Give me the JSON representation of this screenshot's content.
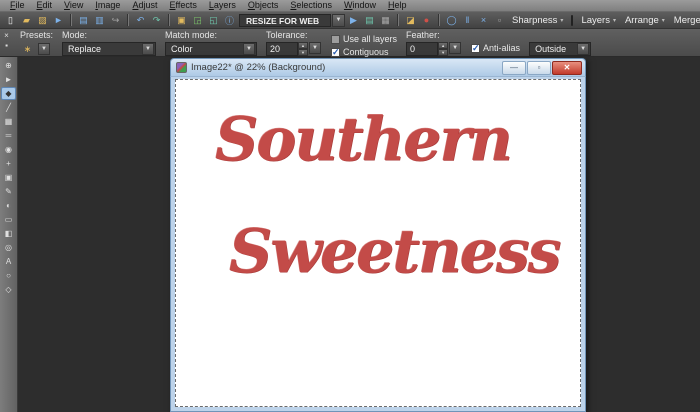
{
  "menu_bar": {
    "items": [
      {
        "label": "File"
      },
      {
        "label": "Edit"
      },
      {
        "label": "View"
      },
      {
        "label": "Image"
      },
      {
        "label": "Adjust"
      },
      {
        "label": "Effects"
      },
      {
        "label": "Layers"
      },
      {
        "label": "Objects"
      },
      {
        "label": "Selections"
      },
      {
        "label": "Window"
      },
      {
        "label": "Help"
      }
    ]
  },
  "toolbar": {
    "file_icons": [
      {
        "name": "new-file-icon",
        "glyph": "▯"
      },
      {
        "name": "open-icon",
        "glyph": "▰"
      },
      {
        "name": "browse-icon",
        "glyph": "▨"
      },
      {
        "name": "import-icon",
        "glyph": "►"
      },
      {
        "name": "save-icon",
        "glyph": "▤"
      },
      {
        "name": "save-as-icon",
        "glyph": "▥"
      },
      {
        "name": "share-icon",
        "glyph": "↪"
      },
      {
        "name": "undo-icon",
        "glyph": "↶"
      },
      {
        "name": "redo-icon",
        "glyph": "↷"
      },
      {
        "name": "paste-icon",
        "glyph": "▣"
      },
      {
        "name": "capture-icon",
        "glyph": "◲"
      },
      {
        "name": "print-icon",
        "glyph": "◱"
      },
      {
        "name": "info-icon",
        "glyph": "ⓘ"
      }
    ],
    "resize_combo": {
      "label": "RESIZE FOR WEB"
    },
    "script_icons": [
      {
        "name": "run-script-icon",
        "glyph": "▶"
      },
      {
        "name": "edit-script-icon",
        "glyph": "▤"
      },
      {
        "name": "script-output-icon",
        "glyph": "▦"
      },
      {
        "name": "open-script-icon",
        "glyph": "◪"
      },
      {
        "name": "stop-script-icon",
        "glyph": "●"
      },
      {
        "name": "record-script-icon",
        "glyph": "◯"
      },
      {
        "name": "pause-script-icon",
        "glyph": "‖"
      },
      {
        "name": "cancel-script-icon",
        "glyph": "×"
      },
      {
        "name": "save-script-icon",
        "glyph": "▫"
      }
    ],
    "right_menus": [
      {
        "label": "Sharpness"
      },
      {
        "label": "Layers"
      },
      {
        "label": "Arrange"
      },
      {
        "label": "Merge"
      }
    ]
  },
  "options_bar": {
    "palette_icons": [
      {
        "name": "close-palette-icon",
        "glyph": "×"
      },
      {
        "name": "dock-palette-icon",
        "glyph": "▪"
      }
    ],
    "presets_label": "Presets:",
    "presets_icon": {
      "name": "magic-wand-icon",
      "glyph": "∗"
    },
    "mode_label": "Mode:",
    "mode_value": "Replace",
    "match_mode_label": "Match mode:",
    "match_mode_value": "Color",
    "tolerance_label": "Tolerance:",
    "tolerance_value": "20",
    "use_all_layers_label": "Use all layers",
    "use_all_layers_checked": false,
    "contiguous_label": "Contiguous",
    "contiguous_checked": true,
    "feather_label": "Feather:",
    "feather_value": "0",
    "anti_alias_label": "Anti-alias",
    "anti_alias_checked": true,
    "edge_mode_value": "Outside"
  },
  "tool_palette": {
    "tools": [
      {
        "name": "pan-tool",
        "glyph": "⊕"
      },
      {
        "name": "pick-tool",
        "glyph": "►"
      },
      {
        "name": "magic-wand-selection-tool",
        "glyph": "◆",
        "active": true
      },
      {
        "name": "dropper-tool",
        "glyph": "╱"
      },
      {
        "name": "crop-tool",
        "glyph": "▦"
      },
      {
        "name": "straighten-tool",
        "glyph": "═"
      },
      {
        "name": "red-eye-tool",
        "glyph": "◉"
      },
      {
        "name": "makeover-tool",
        "glyph": "+"
      },
      {
        "name": "clone-brush-tool",
        "glyph": "▣"
      },
      {
        "name": "paint-brush-tool",
        "glyph": "✎"
      },
      {
        "name": "lighten-darken-tool",
        "glyph": "◐"
      },
      {
        "name": "eraser-tool",
        "glyph": "▭"
      },
      {
        "name": "flood-fill-tool",
        "glyph": "◧"
      },
      {
        "name": "picture-tube-tool",
        "glyph": "◎"
      },
      {
        "name": "text-tool",
        "glyph": "A"
      },
      {
        "name": "preset-shape-tool",
        "glyph": "○"
      },
      {
        "name": "pen-tool",
        "glyph": "◇"
      }
    ]
  },
  "document_window": {
    "title": "Image22* @  22% (Background)",
    "window_buttons": [
      {
        "name": "minimize-button",
        "glyph": "—"
      },
      {
        "name": "restore-button",
        "glyph": "▫"
      },
      {
        "name": "close-button",
        "glyph": "✕"
      }
    ],
    "canvas": {
      "line1": "Southern",
      "line2": "Sweetness",
      "text_color": "#c34b48"
    }
  },
  "colors": {
    "workspace_bg": "#2d2d2d",
    "menubar_bg": "#8a8a8a",
    "titlebar_bg": "#bdd3ea",
    "close_button": "#c23a2b",
    "active_tool_highlight": "#a9c9e9",
    "script_text_red": "#c34b48"
  }
}
